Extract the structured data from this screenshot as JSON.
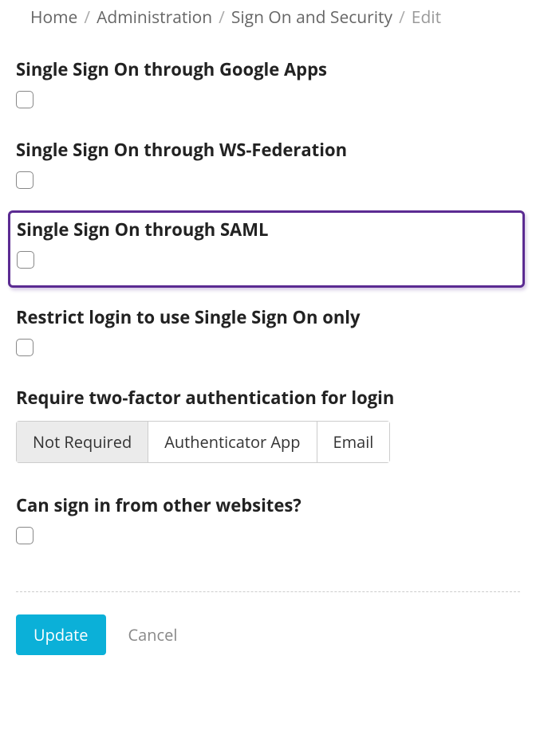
{
  "breadcrumb": {
    "home": "Home",
    "administration": "Administration",
    "security": "Sign On and Security",
    "current": "Edit"
  },
  "sections": {
    "google": "Single Sign On through Google Apps",
    "wsfed": "Single Sign On through WS-Federation",
    "saml": "Single Sign On through SAML",
    "restrict": "Restrict login to use Single Sign On only",
    "twofa": "Require two-factor authentication for login",
    "other_sites": "Can sign in from other websites?"
  },
  "twofa_options": {
    "not_required": "Not Required",
    "authenticator": "Authenticator App",
    "email": "Email"
  },
  "actions": {
    "update": "Update",
    "cancel": "Cancel"
  }
}
